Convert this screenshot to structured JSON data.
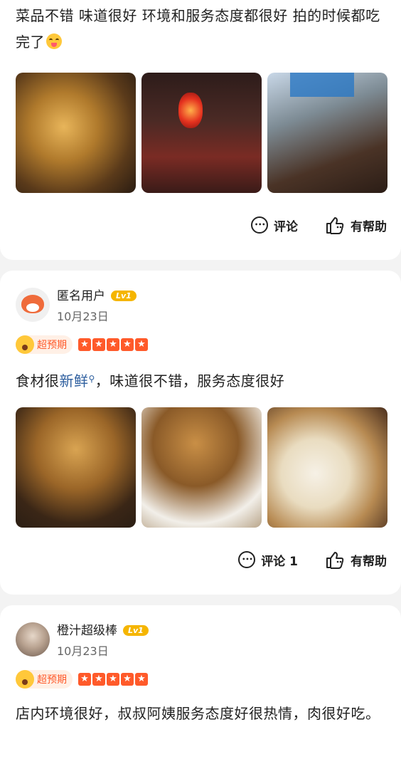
{
  "reviews": [
    {
      "text": "菜品不错 味道很好 环境和服务态度都很好 拍的时候都吃完了",
      "comment_label": "评论",
      "helpful_label": "有帮助"
    },
    {
      "username": "匿名用户",
      "level": "Lv1",
      "date": "10月23日",
      "expect_tag": "超预期",
      "rating": 5,
      "text_before": "食材很",
      "text_link": "新鲜",
      "text_after": "，味道很不错，服务态度很好",
      "comment_label": "评论 1",
      "helpful_label": "有帮助"
    },
    {
      "username": "橙汁超级棒",
      "level": "Lv1",
      "date": "10月23日",
      "expect_tag": "超预期",
      "rating": 5,
      "text": "店内环境很好，叔叔阿姨服务态度好很热情，肉很好吃。"
    }
  ],
  "icons": {
    "comment": "comment-bubble-icon",
    "helpful": "thumbs-up-icon",
    "star": "star-icon",
    "search": "search-icon"
  },
  "colors": {
    "accent": "#ff5a2a",
    "level_badge": "#f5b500",
    "link": "#2d5e9e"
  }
}
